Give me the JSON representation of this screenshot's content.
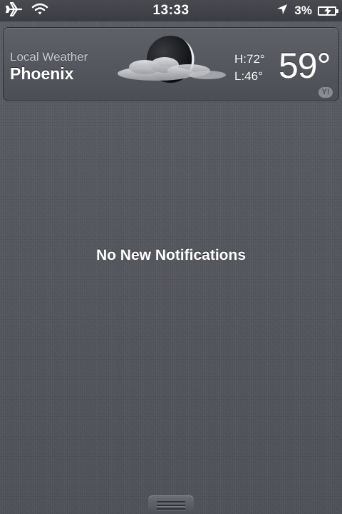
{
  "status_bar": {
    "time": "13:33",
    "battery_percent": "3%",
    "battery_level": 0.03,
    "icons": [
      "airplane-mode-icon",
      "wifi-icon",
      "location-arrow-icon",
      "battery-charging-icon"
    ]
  },
  "weather": {
    "caption": "Local Weather",
    "city": "Phoenix",
    "high": "H:72°",
    "low": "L:46°",
    "temperature": "59°",
    "condition_icon": "night-partly-cloudy-icon",
    "provider_logo": "Y!"
  },
  "notifications": {
    "empty_message": "No New Notifications"
  },
  "colors": {
    "background": "#54565d",
    "text": "#ffffff",
    "caption": "#c9cace"
  }
}
